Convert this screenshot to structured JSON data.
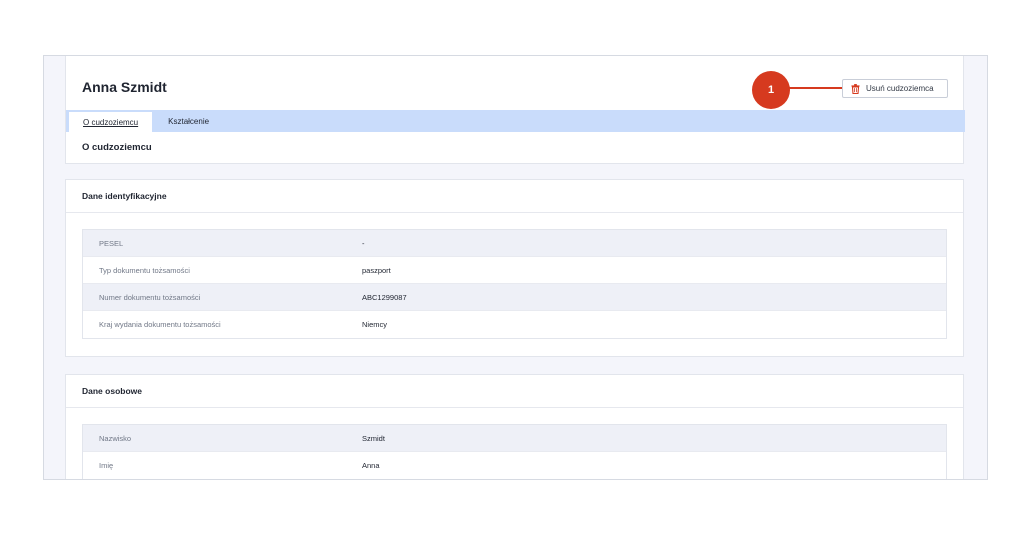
{
  "person": {
    "name": "Anna Szmidt"
  },
  "actions": {
    "delete_label": "Usuń cudzoziemca"
  },
  "tabs": [
    {
      "label": "O cudzoziemcu",
      "active": true
    },
    {
      "label": "Kształcenie",
      "active": false
    }
  ],
  "about_section": {
    "title": "O cudzoziemcu"
  },
  "identification": {
    "title": "Dane identyfikacyjne",
    "rows": [
      {
        "label": "PESEL",
        "value": "-"
      },
      {
        "label": "Typ dokumentu tożsamości",
        "value": "paszport"
      },
      {
        "label": "Numer dokumentu tożsamości",
        "value": "ABC1299087"
      },
      {
        "label": "Kraj wydania dokumentu tożsamości",
        "value": "Niemcy"
      }
    ]
  },
  "personal": {
    "title": "Dane osobowe",
    "rows": [
      {
        "label": "Nazwisko",
        "value": "Szmidt"
      },
      {
        "label": "Imię",
        "value": "Anna"
      }
    ]
  },
  "annotation": {
    "number": "1",
    "color": "#d63a1f"
  },
  "icons": {
    "delete": "trash-icon"
  }
}
